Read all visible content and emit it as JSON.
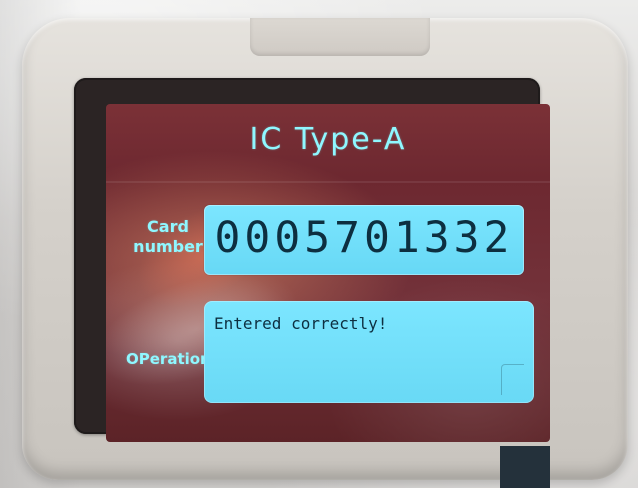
{
  "screen": {
    "title": "IC Type-A",
    "card_label_line1": "Card",
    "card_label_line2": "number",
    "card_number": "0005701332",
    "operation_label": "OPeration",
    "operation_message": "Entered correctly!"
  },
  "colors": {
    "screen_background": "#6d2830",
    "text_cyan": "#8ff7ff",
    "box_cyan": "#7ce6ff",
    "dark_text": "#0d2f40"
  }
}
